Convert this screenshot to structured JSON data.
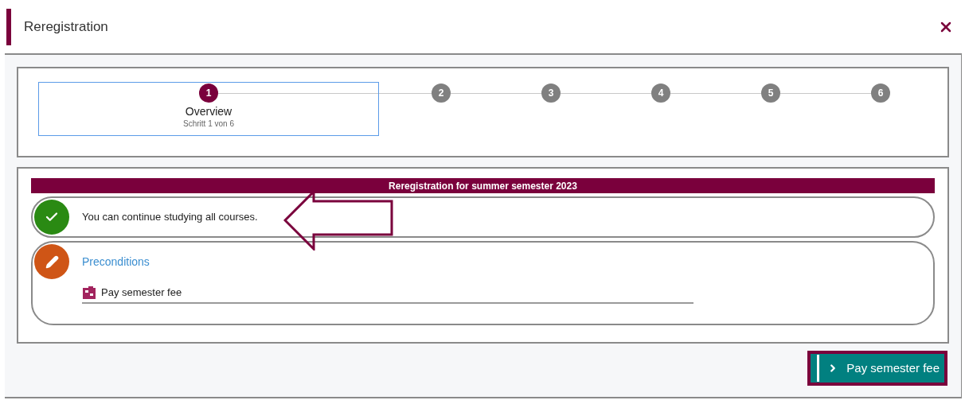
{
  "dialog": {
    "title": "Reregistration"
  },
  "steps": [
    {
      "number": "1",
      "selected": true,
      "label": "Overview",
      "sub": "Schritt 1 von 6"
    },
    {
      "number": "2",
      "selected": false
    },
    {
      "number": "3",
      "selected": false
    },
    {
      "number": "4",
      "selected": false
    },
    {
      "number": "5",
      "selected": false
    },
    {
      "number": "6",
      "selected": false
    }
  ],
  "section": {
    "title": "Reregistration for summer semester 2023",
    "items": [
      {
        "kind": "success",
        "text": "You can continue studying all courses."
      },
      {
        "kind": "pending",
        "link": "Preconditions",
        "tasks": [
          "Pay semester fee"
        ]
      }
    ]
  },
  "action_button": "Pay semester fee"
}
